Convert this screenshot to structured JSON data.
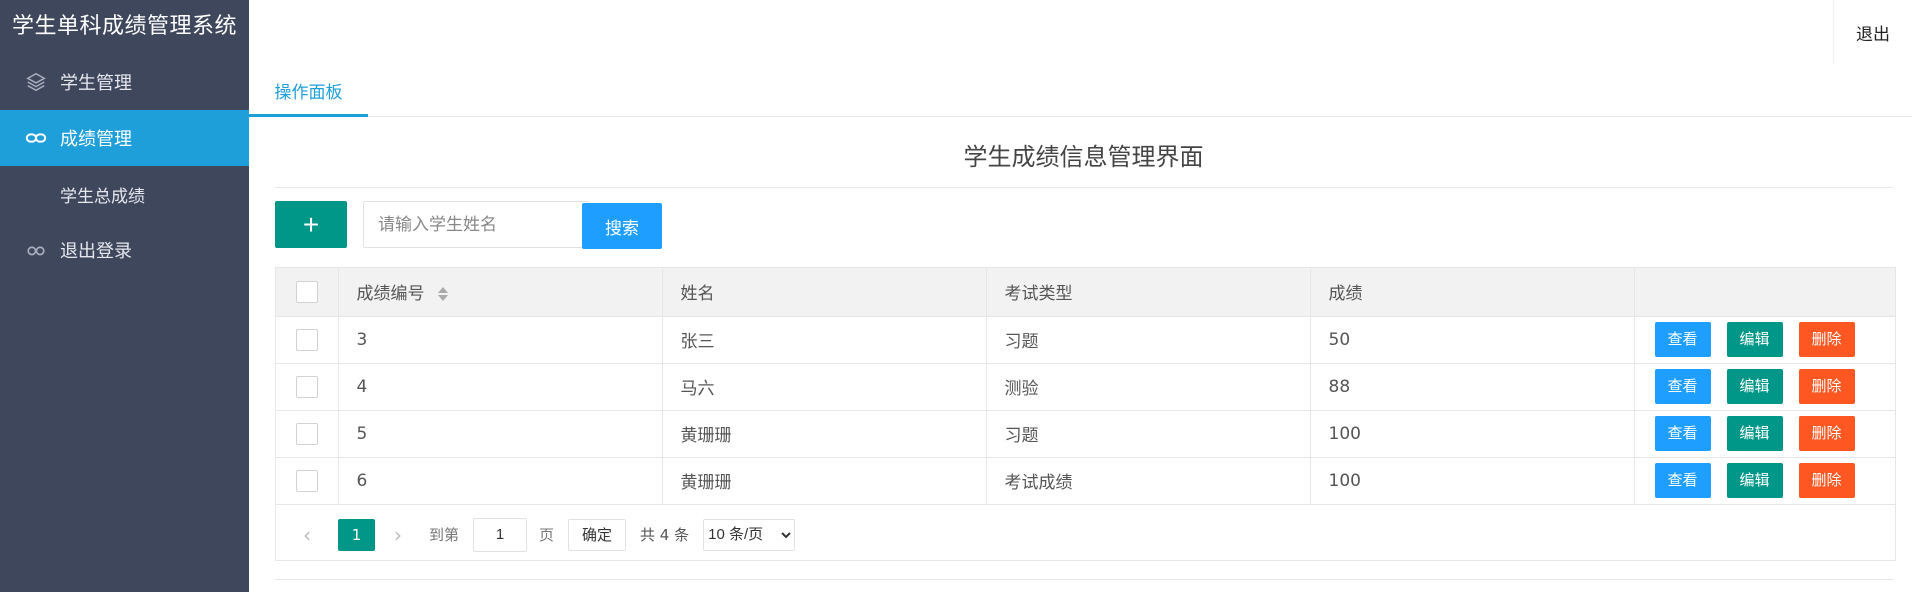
{
  "app": {
    "title": "学生单科成绩管理系统"
  },
  "header": {
    "logout_label": "退出"
  },
  "sidebar": {
    "items": [
      {
        "label": "学生管理",
        "icon": "layers-icon"
      },
      {
        "label": "成绩管理",
        "icon": "link-icon",
        "active": true
      },
      {
        "label": "学生总成绩",
        "icon": ""
      },
      {
        "label": "退出登录",
        "icon": "infinity-icon"
      }
    ]
  },
  "tabs": [
    {
      "label": "操作面板",
      "active": true
    }
  ],
  "page": {
    "title": "学生成绩信息管理界面"
  },
  "toolbar": {
    "add_label": "+",
    "search_placeholder": "请输入学生姓名",
    "search_value": "",
    "search_label": "搜索"
  },
  "table": {
    "columns": [
      "成绩编号",
      "姓名",
      "考试类型",
      "成绩"
    ],
    "rows": [
      {
        "id": "3",
        "name": "张三",
        "type": "习题",
        "score": "50"
      },
      {
        "id": "4",
        "name": "马六",
        "type": "测验",
        "score": "88"
      },
      {
        "id": "5",
        "name": "黄珊珊",
        "type": "习题",
        "score": "100"
      },
      {
        "id": "6",
        "name": "黄珊珊",
        "type": "考试成绩",
        "score": "100"
      }
    ],
    "actions": {
      "view": "查看",
      "edit": "编辑",
      "delete": "删除"
    }
  },
  "pagination": {
    "current_page": "1",
    "goto_label": "到第",
    "goto_value": "1",
    "page_unit": "页",
    "confirm_label": "确定",
    "total_label": "共 4 条",
    "page_size_options": [
      "10 条/页"
    ]
  },
  "colors": {
    "sidebar_bg": "#3f475d",
    "accent_blue": "#1e9fd9",
    "primary_green": "#009688",
    "button_blue": "#1e9fff",
    "danger_orange": "#ff5722"
  }
}
